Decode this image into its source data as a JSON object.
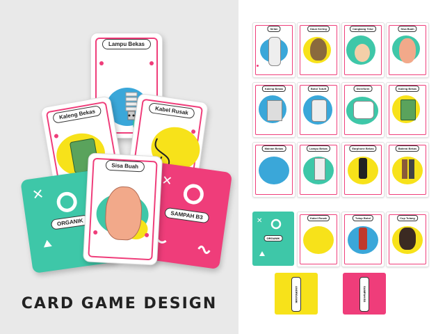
{
  "headline": "CARD GAME DESIGN",
  "showcase": {
    "cards": [
      {
        "label": "Lampu Bekas"
      },
      {
        "label": "Kaleng Bekas"
      },
      {
        "label": "Kabel Rusak"
      },
      {
        "label": "Sisa Buah"
      }
    ],
    "backs": [
      {
        "label": "ORGANIK"
      },
      {
        "label": "SAMPAH B3"
      }
    ]
  },
  "grid": {
    "cards": [
      {
        "label": "Sirlan"
      },
      {
        "label": "Daun Kering"
      },
      {
        "label": "Cangkang Telur"
      },
      {
        "label": "Sisa Buah"
      },
      {
        "label": "Kaleng Bekas"
      },
      {
        "label": "Botol Tutuft"
      },
      {
        "label": "Stereform"
      },
      {
        "label": "Kaleng Bekas"
      },
      {
        "label": "Mainan Bekas"
      },
      {
        "label": "Lampu Bekas"
      },
      {
        "label": "Earphone Bekas"
      },
      {
        "label": "Baterai Bekas"
      },
      {
        "label": "Kabel Rusak"
      },
      {
        "label": "Tutup Botol"
      },
      {
        "label": "Cup Tulang"
      }
    ],
    "backs": [
      {
        "label": "ORGANIK"
      },
      {
        "label": "ANORGANIK"
      },
      {
        "label": "SAMPAH B3"
      }
    ]
  },
  "colors": {
    "pink": "#ef3d7a",
    "teal": "#3ec7a8",
    "yellow": "#f7e21a",
    "blue": "#3aa7d9",
    "bg_left": "#e9e9e9"
  }
}
